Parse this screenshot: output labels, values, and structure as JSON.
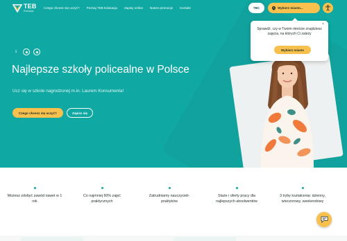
{
  "brand": {
    "name": "TEB",
    "sub": "Edukacja"
  },
  "nav": {
    "links": [
      "Czego chcesz się uczyć?",
      "Poznaj TEB Edukacja",
      "Zapisy online",
      "Nasze promocje",
      "Kontakt"
    ],
    "tbc_label": "TBC",
    "city_label": "Wybierz miasto...",
    "accessibility": "accessibility-icon"
  },
  "popup": {
    "text": "Sprawdź, czy w Twoim mieście znajdziesz zajęcia, na których Ci zależy",
    "button": "Wybierz miasto",
    "close": "×"
  },
  "slider": {
    "current": "1"
  },
  "hero": {
    "title": "Najlepsze szkoły policealne w Polsce",
    "subtitle": "Ucz się w szkole nagrodzonej m.in. Laurem Konsumenta!",
    "primary_button": "Czego chcesz się uczyć?",
    "secondary_button": "Zapisz się"
  },
  "features": [
    "Możesz zdobyć zawód nawet w 1 rok",
    "Co najmniej 60% zajęć praktycznych",
    "Zatrudniamy nauczycieli-praktyków",
    "Staże i oferty pracy dla najlepszych absolwentów",
    "3 tryby kształcenia: dzienny, wieczorowy, weekendowy"
  ],
  "colors": {
    "teal": "#0fa8a3",
    "yellow": "#f8c04d",
    "dark": "#1d2b2a"
  }
}
